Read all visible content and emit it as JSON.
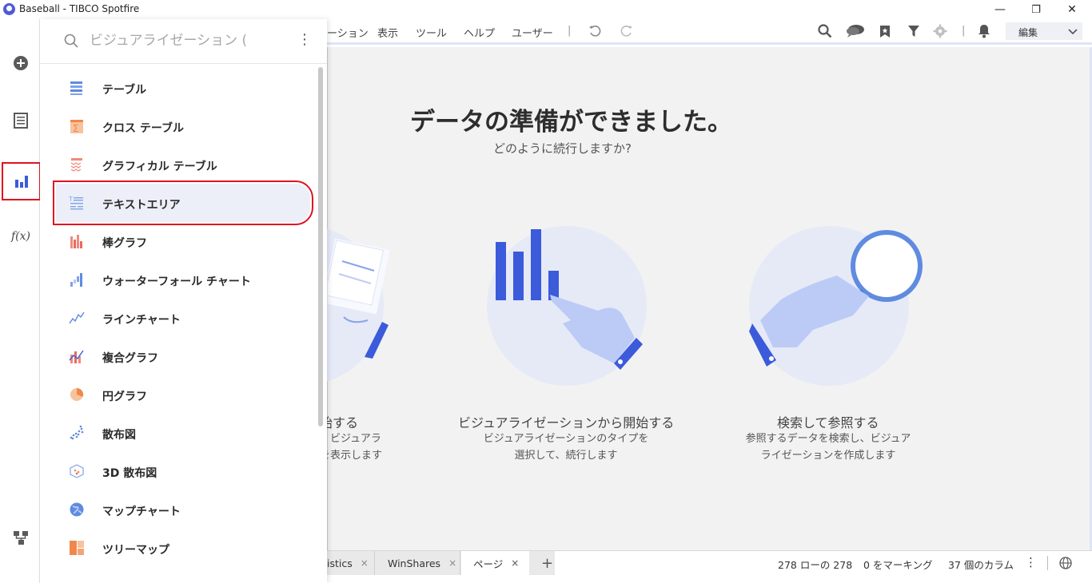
{
  "window": {
    "title": "Baseball - TIBCO Spotfire",
    "minimize": "—",
    "restore": "❐",
    "close": "✕"
  },
  "rail": {
    "items": [
      {
        "name": "add-icon"
      },
      {
        "name": "data-table-icon"
      },
      {
        "name": "visualization-icon",
        "selected": true
      },
      {
        "name": "function-icon",
        "label": "f(x)"
      },
      {
        "name": "data-canvas-icon"
      }
    ]
  },
  "panel": {
    "search_placeholder": "ビジュアライゼーション (",
    "more_icon": "more-vertical-icon",
    "items": [
      {
        "label": "テーブル",
        "icon": "table-icon"
      },
      {
        "label": "クロス テーブル",
        "icon": "cross-table-icon"
      },
      {
        "label": "グラフィカル テーブル",
        "icon": "graphical-table-icon"
      },
      {
        "label": "テキストエリア",
        "icon": "text-area-icon",
        "selected": true
      },
      {
        "label": "棒グラフ",
        "icon": "bar-chart-icon"
      },
      {
        "label": "ウォーターフォール チャート",
        "icon": "waterfall-chart-icon"
      },
      {
        "label": "ラインチャート",
        "icon": "line-chart-icon"
      },
      {
        "label": "複合グラフ",
        "icon": "combination-chart-icon"
      },
      {
        "label": "円グラフ",
        "icon": "pie-chart-icon"
      },
      {
        "label": "散布図",
        "icon": "scatter-plot-icon"
      },
      {
        "label": "3D 散布図",
        "icon": "3d-scatter-plot-icon"
      },
      {
        "label": "マップチャート",
        "icon": "map-chart-icon"
      },
      {
        "label": "ツリーマップ",
        "icon": "treemap-icon"
      }
    ]
  },
  "menubar": {
    "items": [
      "ーション",
      "表示",
      "ツール",
      "ヘルプ",
      "ユーザー"
    ],
    "separator": "|",
    "edit_dropdown": "編集"
  },
  "main": {
    "title": "データの準備ができました。",
    "subtitle": "どのように続行しますか?",
    "cards": [
      {
        "title": "始する",
        "desc_lines": [
          "、ビジュアラ",
          "を表示します"
        ]
      },
      {
        "title": "ビジュアライゼーションから開始する",
        "desc_lines": [
          "ビジュアライゼーションのタイプを",
          "選択して、続行します"
        ]
      },
      {
        "title": "検索して参照する",
        "desc_lines": [
          "参照するデータを検索し、ビジュア",
          "ライゼーションを作成します"
        ]
      }
    ]
  },
  "statusbar": {
    "tabs": [
      {
        "label": "istics",
        "close": "×"
      },
      {
        "label": "WinShares",
        "close": "×"
      },
      {
        "label": "ページ",
        "close": "×",
        "active": true
      }
    ],
    "add_tab": "+",
    "rows": "278 ローの 278",
    "marked": "0 をマーキング",
    "columns": "37 個のカラム",
    "more": "⋮"
  },
  "colors": {
    "accent_blue": "#3b5bdb",
    "highlight_red": "#e0121f",
    "orange": "#f0884d"
  }
}
